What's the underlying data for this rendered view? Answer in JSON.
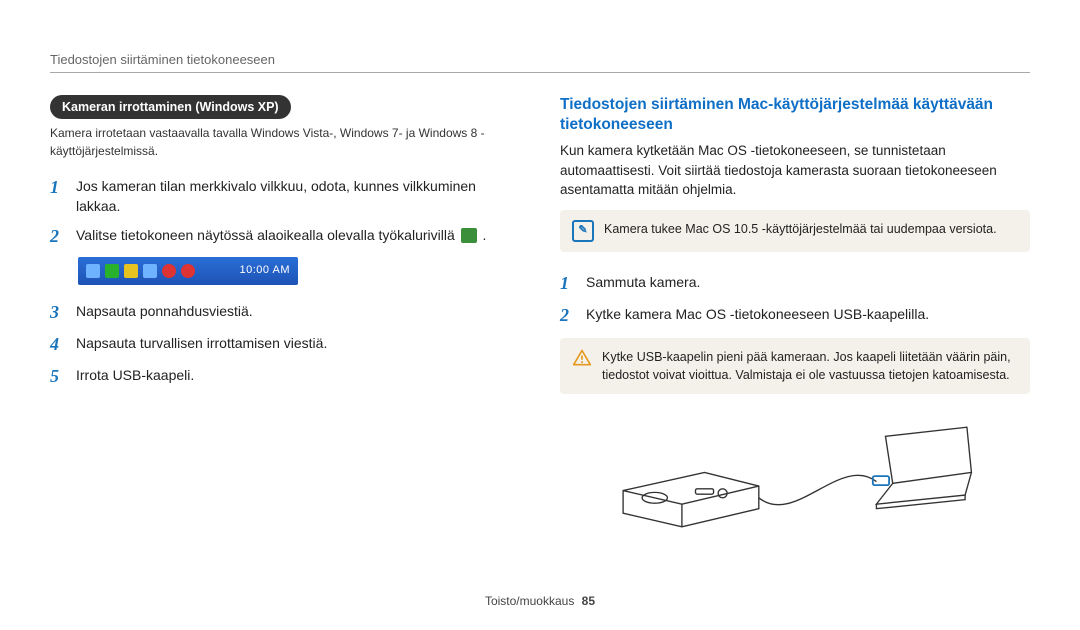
{
  "header": {
    "running_title": "Tiedostojen siirtäminen tietokoneeseen"
  },
  "left": {
    "pill": "Kameran irrottaminen (Windows XP)",
    "pill_note": "Kamera irrotetaan vastaavalla tavalla Windows Vista-, Windows 7- ja Windows 8 -käyttöjärjestelmissä.",
    "steps": {
      "s1": "Jos kameran tilan merkkivalo vilkkuu, odota, kunnes vilkkuminen lakkaa.",
      "s2": "Valitse tietokoneen näytössä alaoikealla olevalla työkalurivillä",
      "s3": "Napsauta ponnahdusviestiä.",
      "s4": "Napsauta turvallisen irrottamisen viestiä.",
      "s5": "Irrota USB-kaapeli."
    },
    "taskbar_time": "10:00 AM"
  },
  "right": {
    "heading": "Tiedostojen siirtäminen Mac-käyttöjärjestelmää käyttävään tietokoneeseen",
    "intro": "Kun kamera kytketään Mac OS -tietokoneeseen, se tunnistetaan automaattisesti. Voit siirtää tiedostoja kamerasta suoraan tietokoneeseen asentamatta mitään ohjelmia.",
    "note_box": "Kamera tukee Mac OS 10.5 -käyttöjärjestelmää tai uudempaa versiota.",
    "steps": {
      "s1": "Sammuta kamera.",
      "s2": "Kytke kamera Mac OS -tietokoneeseen USB-kaapelilla."
    },
    "warn_box": "Kytke USB-kaapelin pieni pää kameraan. Jos kaapeli liitetään väärin päin, tiedostot voivat vioittua. Valmistaja ei ole vastuussa tietojen katoamisesta."
  },
  "footer": {
    "section": "Toisto/muokkaus",
    "page": "85"
  }
}
